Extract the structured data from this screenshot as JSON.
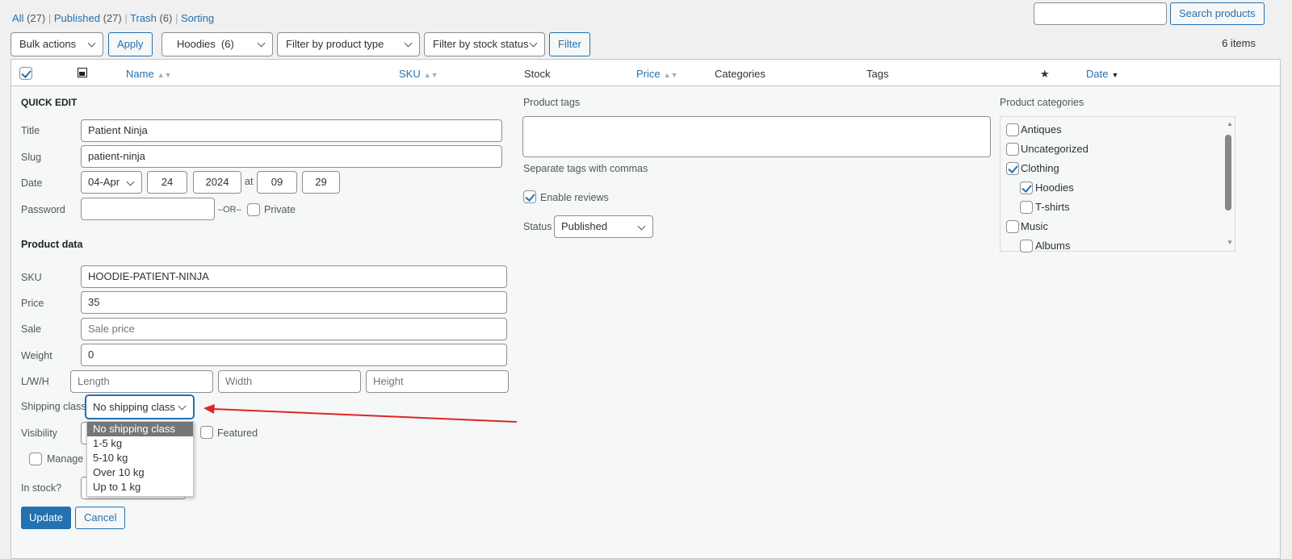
{
  "views": [
    {
      "label": "All",
      "count": "(27)"
    },
    {
      "label": "Published",
      "count": "(27)"
    },
    {
      "label": "Trash",
      "count": "(6)"
    },
    {
      "label": "Sorting",
      "count": ""
    }
  ],
  "search": {
    "value": "",
    "button": "Search products"
  },
  "toolbar": {
    "bulk": "Bulk actions",
    "apply": "Apply",
    "category": "Hoodies  (6)",
    "product_type": "Filter by product type",
    "stock_status": "Filter by stock status",
    "filter": "Filter",
    "items": "6 items"
  },
  "columns": {
    "name": "Name",
    "sku": "SKU",
    "stock": "Stock",
    "price": "Price",
    "categories": "Categories",
    "tags": "Tags",
    "date": "Date"
  },
  "quick_edit": {
    "heading": "QUICK EDIT",
    "title_label": "Title",
    "title": "Patient Ninja",
    "slug_label": "Slug",
    "slug": "patient-ninja",
    "date_label": "Date",
    "month": "04-Apr",
    "day": "24",
    "year": "2024",
    "at": "at",
    "hour": "09",
    "minute": "29",
    "password_label": "Password",
    "or": "–OR–",
    "private": "Private",
    "product_data": "Product data",
    "sku_label": "SKU",
    "sku": "HOODIE-PATIENT-NINJA",
    "price_label": "Price",
    "price": "35",
    "sale_label": "Sale",
    "sale_placeholder": "Sale price",
    "weight_label": "Weight",
    "weight": "0",
    "lwh_label": "L/W/H",
    "length_ph": "Length",
    "width_ph": "Width",
    "height_ph": "Height",
    "shipping_label": "Shipping class",
    "shipping": "No shipping class",
    "shipping_options": [
      "No shipping class",
      "1-5 kg",
      "5-10 kg",
      "Over 10 kg",
      "Up to 1 kg"
    ],
    "visibility_label": "Visibility",
    "featured": "Featured",
    "manage_stock": "Manage s",
    "in_stock_label": "In stock?",
    "update": "Update",
    "cancel": "Cancel",
    "tags_label": "Product tags",
    "tags_help": "Separate tags with commas",
    "enable_reviews": "Enable reviews",
    "status_label": "Status",
    "status": "Published",
    "categories_label": "Product categories",
    "categories": [
      {
        "name": "Antiques",
        "checked": false
      },
      {
        "name": "Uncategorized",
        "checked": false
      },
      {
        "name": "Clothing",
        "checked": true
      },
      {
        "name": "Hoodies",
        "checked": true
      },
      {
        "name": "T-shirts",
        "checked": false
      },
      {
        "name": "Music",
        "checked": false
      },
      {
        "name": "Albums",
        "checked": false
      }
    ]
  },
  "colors": {
    "accent": "#2271b1",
    "arrow": "#e02424",
    "selected_option": "#767676"
  }
}
